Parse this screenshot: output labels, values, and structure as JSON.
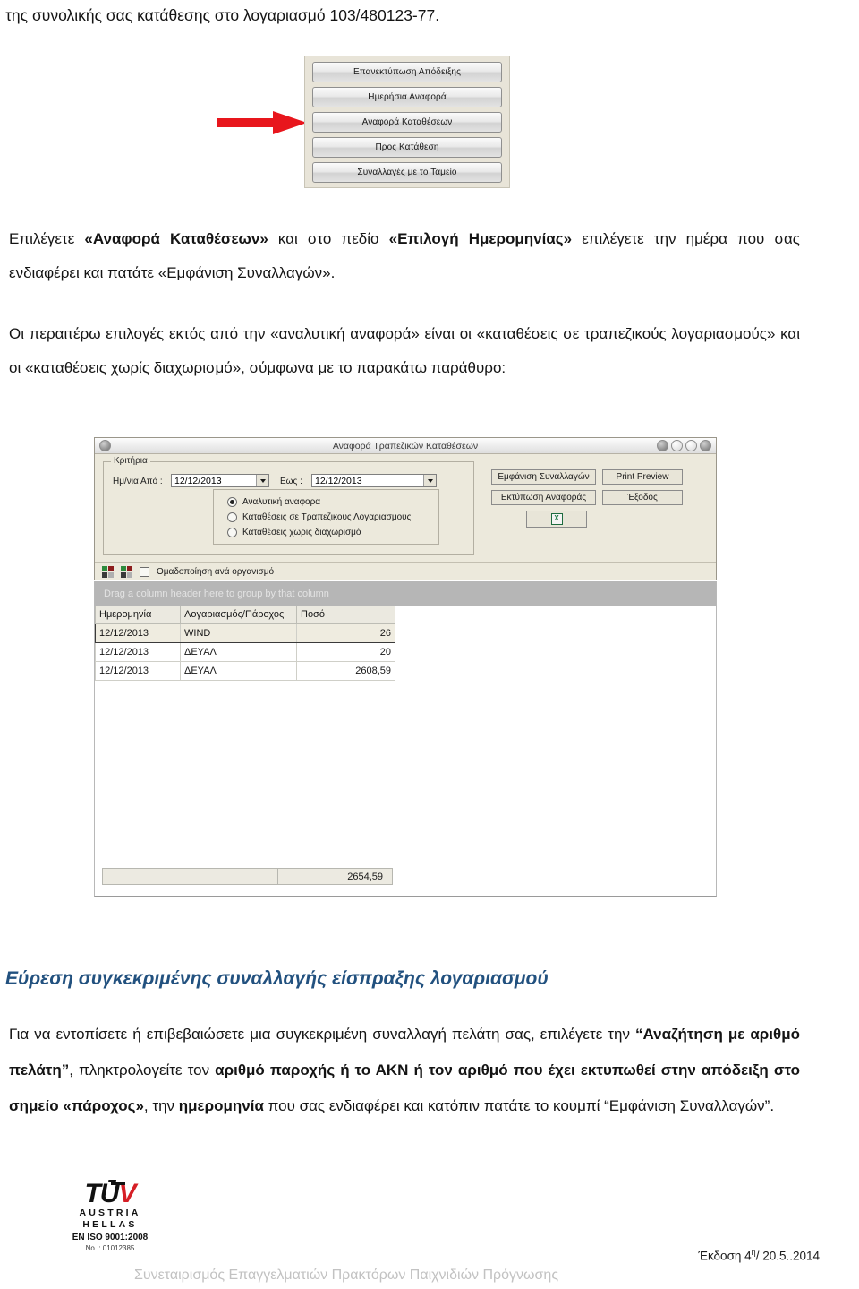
{
  "document": {
    "top_line": "της συνολικής σας κατάθεσης στο λογαριασμό 103/480123-77."
  },
  "button_panel": {
    "items": [
      "Επανεκτύπωση Απόδειξης",
      "Ημερήσια Αναφορά",
      "Αναφορά Καταθέσεων",
      "Προς Κατάθεση",
      "Συναλλαγές με το Ταμείο"
    ],
    "highlighted_index": 2,
    "arrow_color": "#e8161d"
  },
  "paragraphs": {
    "p1_part1": "Επιλέγετε ",
    "p1_bold1": "«Αναφορά Καταθέσεων»",
    "p1_part2": " και στο πεδίο ",
    "p1_bold2": "«Επιλογή Ημερομηνίας»",
    "p1_part3": " επιλέγετε την ημέρα που σας ενδιαφέρει και πατάτε «Εμφάνιση Συναλλαγών».",
    "p2": "Οι περαιτέρω επιλογές εκτός από την «αναλυτική αναφορά» είναι οι «καταθέσεις σε τραπεζικούς λογαριασμούς» και οι «καταθέσεις χωρίς διαχωρισμό», σύμφωνα με το παρακάτω παράθυρο:"
  },
  "app_window": {
    "title": "Αναφορά Τραπεζικών Καταθέσεων",
    "criteria": {
      "legend": "Κριτήρια",
      "from_label": "Ημ/νια Από :",
      "from_value": "12/12/2013",
      "to_label": "Εως :",
      "to_value": "12/12/2013",
      "radios": [
        {
          "label": "Αναλυτική αναφορα",
          "selected": true
        },
        {
          "label": "Καταθέσεις σε Τραπεζικους Λογαριασμους",
          "selected": false
        },
        {
          "label": "Καταθέσεις χωρις διαχωρισμό",
          "selected": false
        }
      ]
    },
    "commands": {
      "show_transactions": "Εμφάνιση Συναλλαγών",
      "print_preview": "Print Preview",
      "print_report": "Εκτύπωση Αναφοράς",
      "exit": "Έξοδος",
      "excel_glyph": "X"
    },
    "toolbar": {
      "group_checkbox_label": "Ομαδοποίηση ανά οργανισμό",
      "group_checkbox_checked": false
    },
    "grid": {
      "group_hint": "Drag a column header here to group by that column",
      "columns": [
        "Ημερομηνία",
        "Λογαριασμός/Πάροχος",
        "Ποσό"
      ],
      "rows": [
        {
          "date": "12/12/2013",
          "account": "WIND",
          "amount": "26",
          "selected": true
        },
        {
          "date": "12/12/2013",
          "account": "ΔΕΥΑΛ",
          "amount": "20",
          "selected": false
        },
        {
          "date": "12/12/2013",
          "account": "ΔΕΥΑΛ",
          "amount": "2608,59",
          "selected": false
        }
      ],
      "footer_total": "2654,59"
    }
  },
  "section": {
    "heading": "Εύρεση συγκεκριμένης συναλλαγής είσπραξης λογαριασμού",
    "heading_color": "#22517f",
    "body_part1": "Για να εντοπίσετε ή επιβεβαιώσετε μια συγκεκριμένη συναλλαγή πελάτη σας, επιλέγετε την ",
    "body_bold1": "“Αναζήτηση με αριθμό πελάτη”",
    "body_part2": ", πληκτρολογείτε τον ",
    "body_bold2": "αριθμό παροχής ή το ΑΚΝ ή τον αριθμό που έχει εκτυπωθεί στην απόδειξη στο σημείο «πάροχος»",
    "body_part3": ", την ",
    "body_bold3": "ημερομηνία",
    "body_part4": " που σας ενδιαφέρει και κατόπιν πατάτε το κουμπί “Εμφάνιση Συναλλαγών”."
  },
  "footer": {
    "tuv_mark": "TŪV",
    "tuv_line1": "AUSTRIA",
    "tuv_line2": "HELLAS",
    "tuv_iso": "EN ISO 9001:2008",
    "tuv_no": "No. : 01012385",
    "edition": "Έκδοση 4",
    "edition_sup": "η",
    "edition_rest": "/ 20.5..2014",
    "organization": "Συνεταιρισμός Επαγγελματιών Πρακτόρων Παιχνιδιών Πρόγνωσης"
  }
}
